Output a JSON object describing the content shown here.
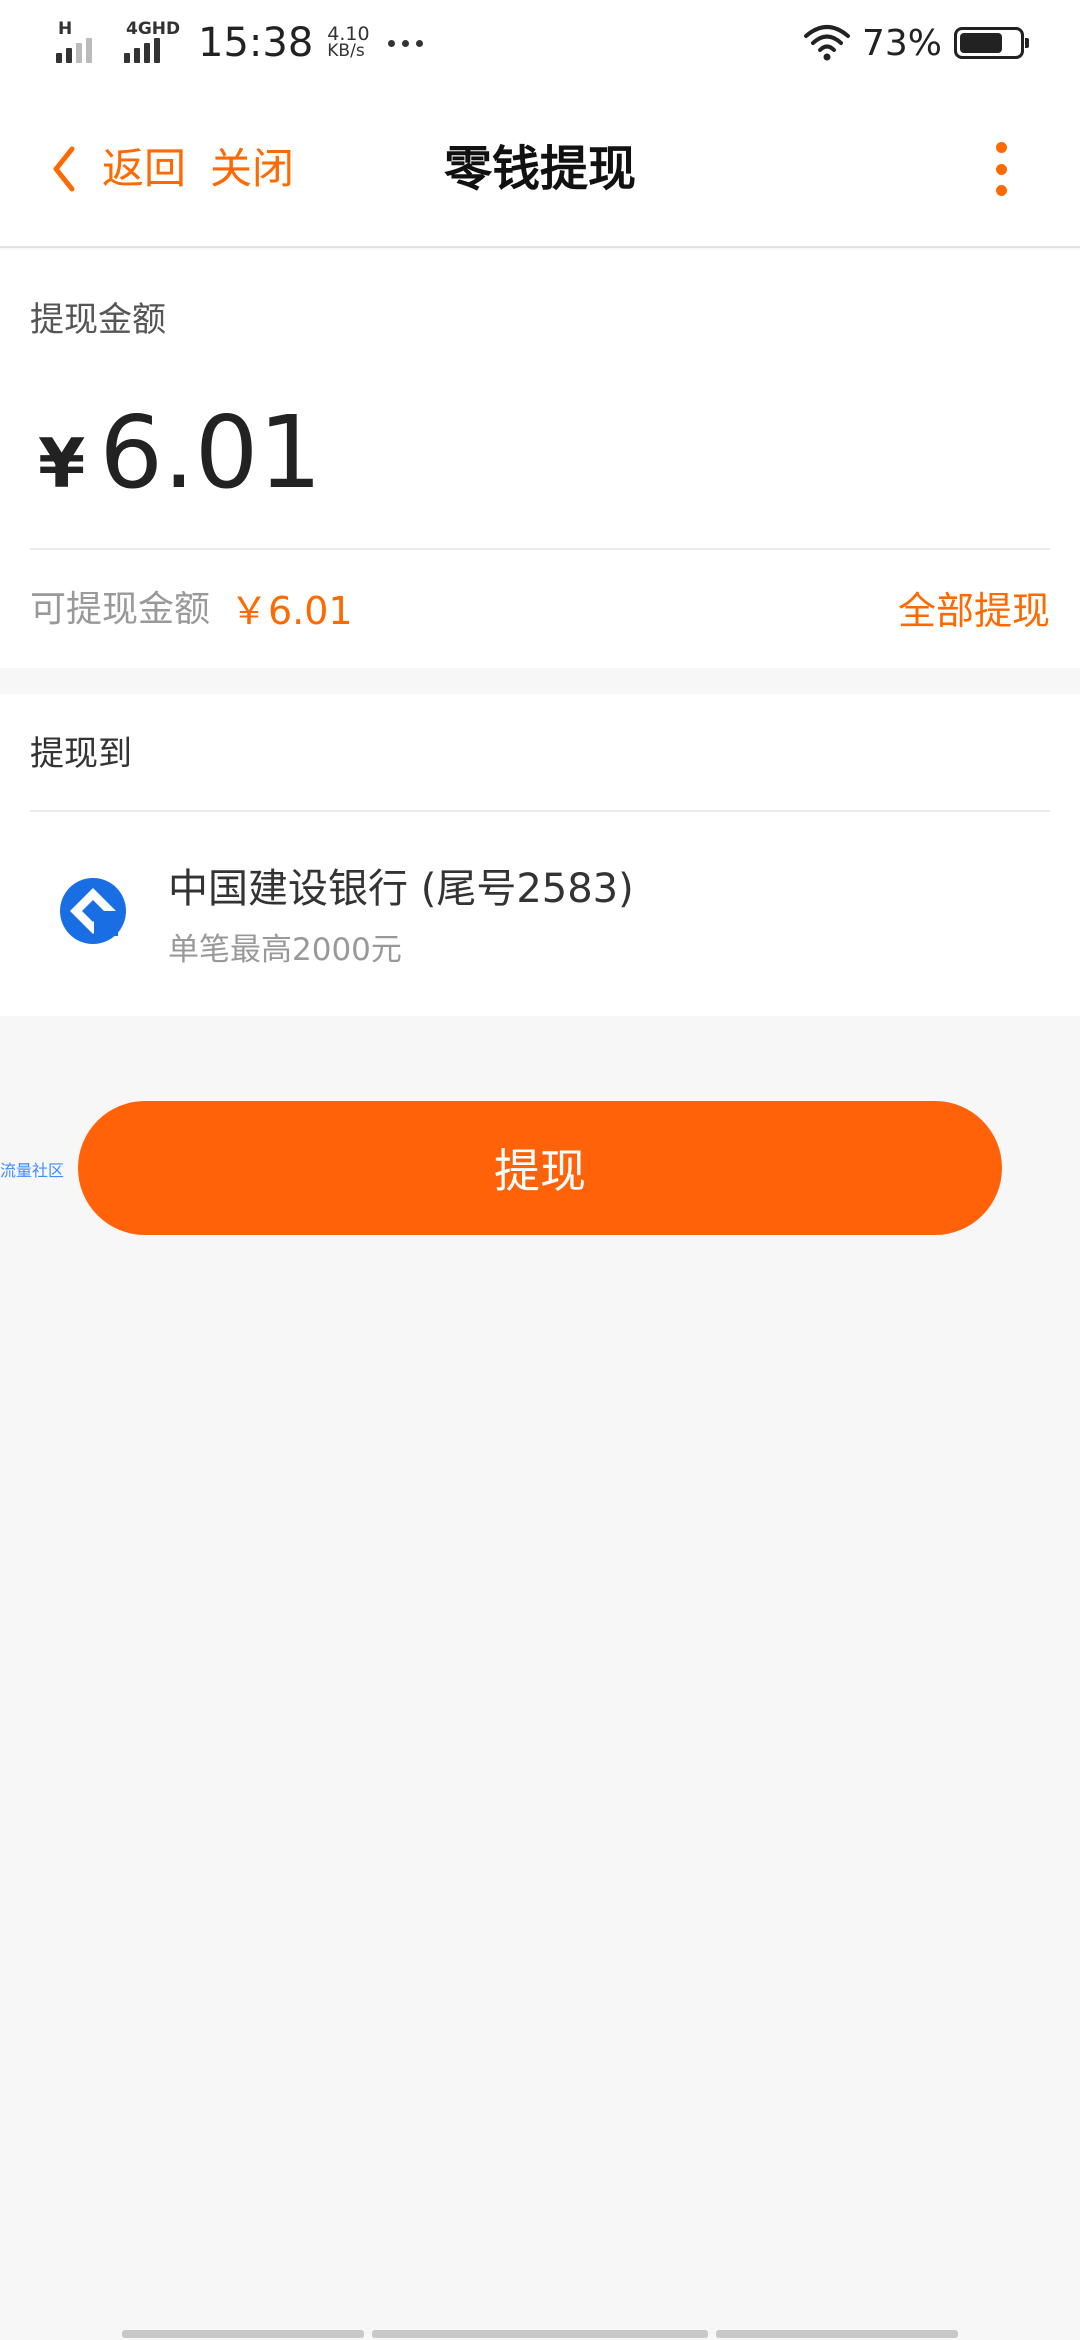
{
  "status_bar": {
    "signal1_label": "H",
    "signal2_label": "4GHD",
    "time": "15:38",
    "speed_value": "4.10",
    "speed_unit": "KB/s",
    "battery_percent": "73%",
    "battery_level": 0.73
  },
  "nav": {
    "back_label": "返回",
    "close_label": "关闭",
    "title": "零钱提现"
  },
  "amount_card": {
    "label": "提现金额",
    "currency": "¥",
    "value": "6.01",
    "available_label": "可提现金额",
    "available_value": "￥6.01",
    "withdraw_all_label": "全部提现"
  },
  "destination_card": {
    "label": "提现到",
    "bank_name": "中国建设银行 (尾号2583)",
    "limit_text": "单笔最高2000元",
    "bank_logo_color": "#1a6ee3"
  },
  "side_label": "流量社区",
  "withdraw_button_label": "提现",
  "colors": {
    "accent": "#ff6a00",
    "button": "#ff6208"
  }
}
